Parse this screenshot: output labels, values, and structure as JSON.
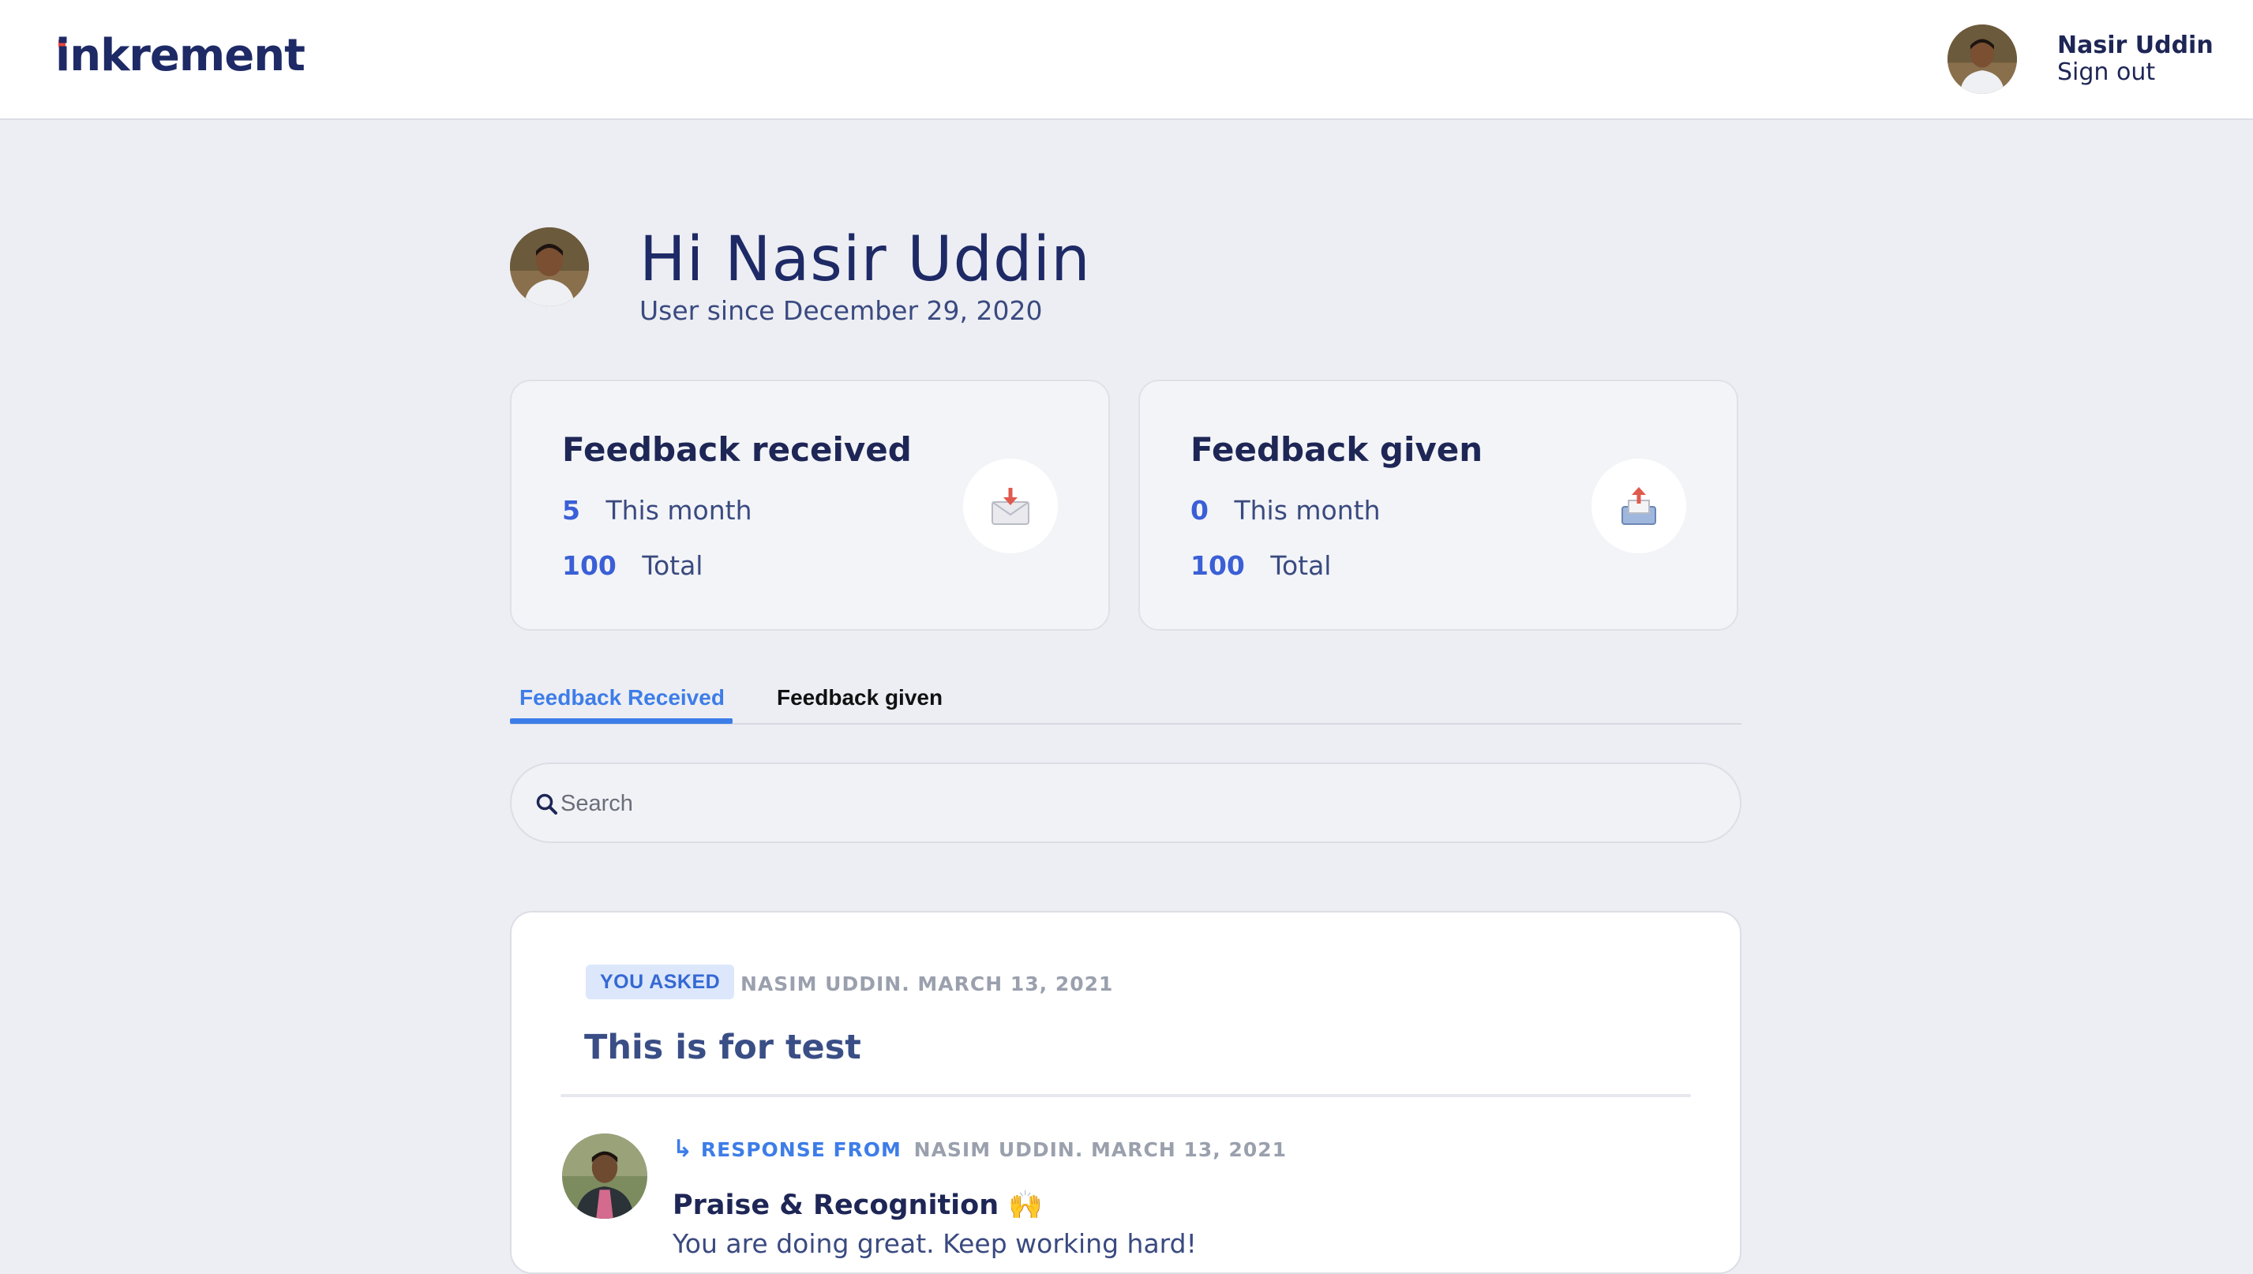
{
  "header": {
    "logo": "inkrement",
    "user_name": "Nasir Uddin",
    "signout_label": "Sign out"
  },
  "greeting": {
    "title": "Hi Nasir Uddin",
    "subtitle": "User since December 29, 2020"
  },
  "stats": {
    "received": {
      "title": "Feedback received",
      "month_value": "5",
      "month_label": "This month",
      "total_value": "100",
      "total_label": "Total",
      "icon": "inbox-tray-icon"
    },
    "given": {
      "title": "Feedback given",
      "month_value": "0",
      "month_label": "This month",
      "total_value": "100",
      "total_label": "Total",
      "icon": "outbox-tray-icon"
    }
  },
  "tabs": [
    {
      "label": "Feedback Received",
      "active": true
    },
    {
      "label": "Feedback given",
      "active": false
    }
  ],
  "search": {
    "placeholder": "Search",
    "value": ""
  },
  "feed": [
    {
      "badge": "YOU ASKED",
      "meta": "NASIM UDDIN. MARCH 13, 2021",
      "title": "This is for test",
      "response": {
        "arrow": "↳",
        "from_label": "RESPONSE FROM",
        "meta": "NASIM UDDIN. MARCH 13, 2021",
        "type": "Praise & Recognition 🙌",
        "text": "You are doing great. Keep working hard!"
      }
    }
  ],
  "colors": {
    "accent": "#3d7de8",
    "navy": "#1e2656",
    "stat_number": "#3a5fd6",
    "background": "#edeef3",
    "logo_dot": "#e8463c"
  }
}
